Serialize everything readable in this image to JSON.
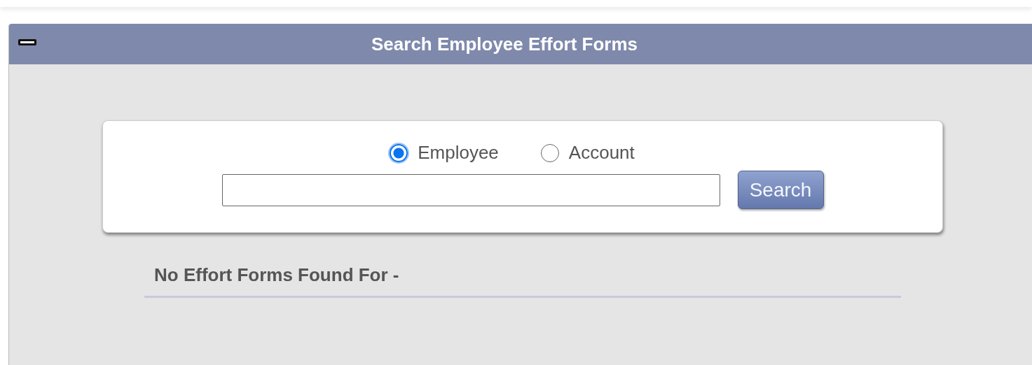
{
  "panel": {
    "title": "Search Employee Effort Forms"
  },
  "search": {
    "options": [
      {
        "label": "Employee",
        "selected": true
      },
      {
        "label": "Account",
        "selected": false
      }
    ],
    "button": "Search"
  },
  "result_message": "No Effort Forms Found For -"
}
